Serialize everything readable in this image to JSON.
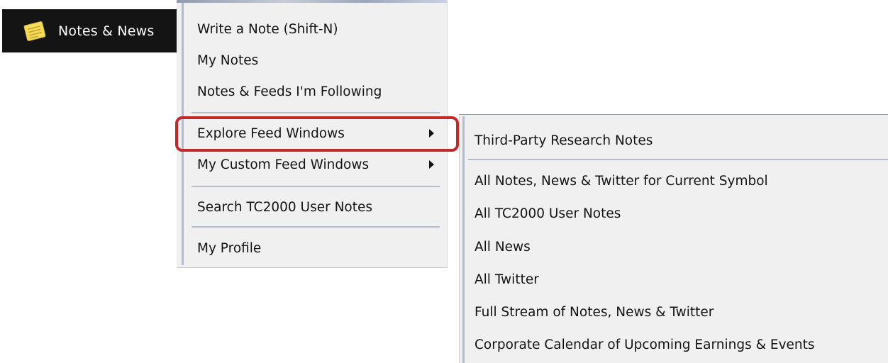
{
  "button": {
    "label": "Notes & News",
    "icon": "notepad-icon"
  },
  "main_menu": {
    "items": [
      {
        "label": "Write a Note (Shift-N)"
      },
      {
        "label": "My Notes"
      },
      {
        "label": "Notes & Feeds I'm Following"
      },
      {
        "label": "Explore Feed Windows",
        "has_submenu": true,
        "highlighted": true
      },
      {
        "label": "My Custom Feed Windows",
        "has_submenu": true
      },
      {
        "label": "Search TC2000 User Notes"
      },
      {
        "label": "My Profile"
      }
    ]
  },
  "submenu": {
    "items": [
      {
        "label": "Third-Party Research Notes"
      },
      {
        "label": "All Notes, News & Twitter for Current Symbol"
      },
      {
        "label": "All TC2000 User Notes"
      },
      {
        "label": "All News"
      },
      {
        "label": "All Twitter"
      },
      {
        "label": "Full Stream of Notes, News & Twitter"
      },
      {
        "label": "Corporate Calendar of Upcoming Earnings & Events"
      }
    ]
  },
  "colors": {
    "button_bg": "#141414",
    "menu_bg": "#f0f0f0",
    "highlight": "#bf2b2b",
    "separator": "#b6bccb",
    "icon_yellow": "#f5dc5a"
  }
}
